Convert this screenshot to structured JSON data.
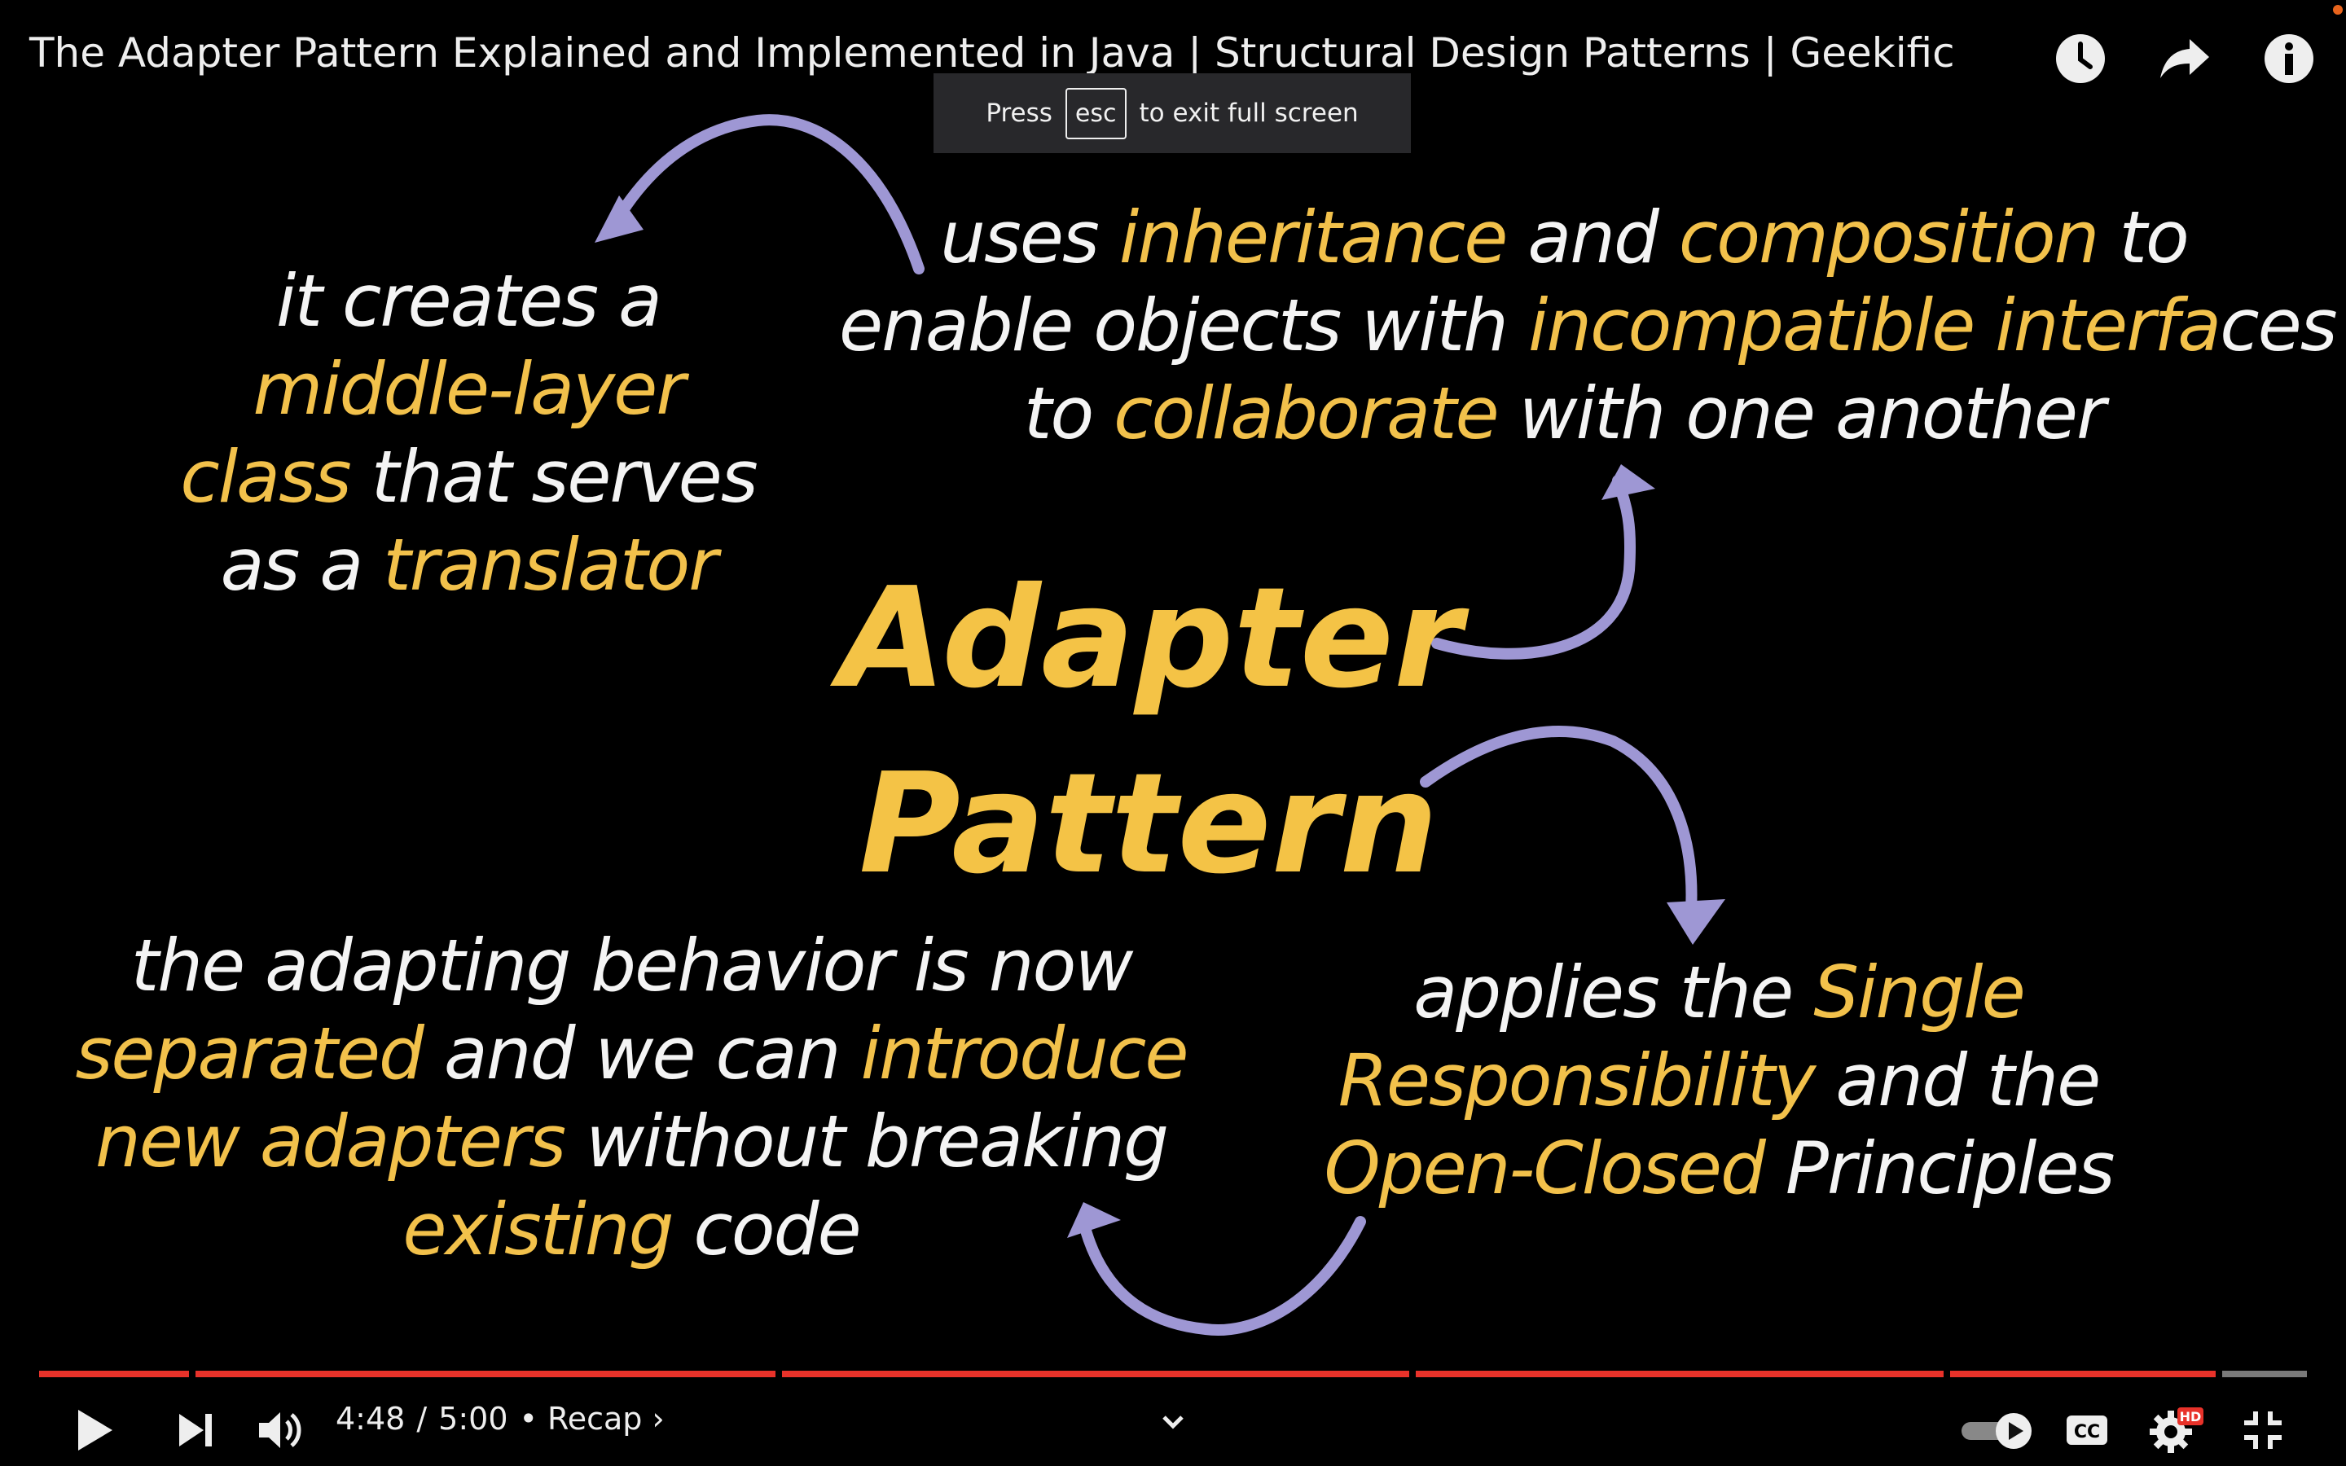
{
  "video": {
    "title": "The Adapter Pattern Explained and Implemented in Java | Structural Design Patterns | Geekific"
  },
  "fullscreen_notice": {
    "before": "Press",
    "key": "esc",
    "after": "to exit full screen"
  },
  "slide": {
    "center_line1": "Adapter",
    "center_line2": "Pattern",
    "top_left": [
      [
        {
          "t": "it creates a",
          "h": false
        }
      ],
      [
        {
          "t": "middle-layer",
          "h": true
        }
      ],
      [
        {
          "t": "class",
          "h": true
        },
        {
          "t": " that serves",
          "h": false
        }
      ],
      [
        {
          "t": "as a ",
          "h": false
        },
        {
          "t": "translator",
          "h": true
        }
      ]
    ],
    "top_right": [
      [
        {
          "t": "uses ",
          "h": false
        },
        {
          "t": "inheritance",
          "h": true
        },
        {
          "t": " and ",
          "h": false
        },
        {
          "t": "composition",
          "h": true
        },
        {
          "t": " to",
          "h": false
        }
      ],
      [
        {
          "t": "enable objects with ",
          "h": false
        },
        {
          "t": "incompatible interfa",
          "h": true
        },
        {
          "t": "ces",
          "h": false
        }
      ],
      [
        {
          "t": "to ",
          "h": false
        },
        {
          "t": "collaborate",
          "h": true
        },
        {
          "t": " with one another",
          "h": false
        }
      ]
    ],
    "bottom_left": [
      [
        {
          "t": "the adapting behavior is now",
          "h": false
        }
      ],
      [
        {
          "t": "separated",
          "h": true
        },
        {
          "t": " and we can ",
          "h": false
        },
        {
          "t": "introduce",
          "h": true
        }
      ],
      [
        {
          "t": "new adapters",
          "h": true
        },
        {
          "t": " without breaking",
          "h": false
        }
      ],
      [
        {
          "t": "existing",
          "h": true
        },
        {
          "t": " code",
          "h": false
        }
      ]
    ],
    "bottom_right": [
      [
        {
          "t": "applies the ",
          "h": false
        },
        {
          "t": "Single",
          "h": true
        }
      ],
      [
        {
          "t": "Responsibility",
          "h": true
        },
        {
          "t": " and the",
          "h": false
        }
      ],
      [
        {
          "t": "Open-Closed",
          "h": true
        },
        {
          "t": " Principles",
          "h": false
        }
      ]
    ]
  },
  "player": {
    "current_time": "4:48",
    "separator": "/",
    "duration": "5:00",
    "chapter": "• Recap",
    "progress_fraction": 0.96,
    "hd_badge": "HD",
    "cc_label": "CC"
  },
  "icons": {
    "watch_later": "clock-icon",
    "share": "share-arrow-icon",
    "info": "info-icon",
    "play": "play-icon",
    "next": "next-icon",
    "volume": "volume-icon",
    "expand": "chevron-down-icon",
    "autoplay": "autoplay-toggle-icon",
    "captions": "captions-icon",
    "settings": "gear-icon",
    "exit_fullscreen": "exit-fullscreen-icon"
  },
  "colors": {
    "highlight": "#f2c14b",
    "progress": "#e8322a",
    "arrow": "#9e97d4"
  }
}
